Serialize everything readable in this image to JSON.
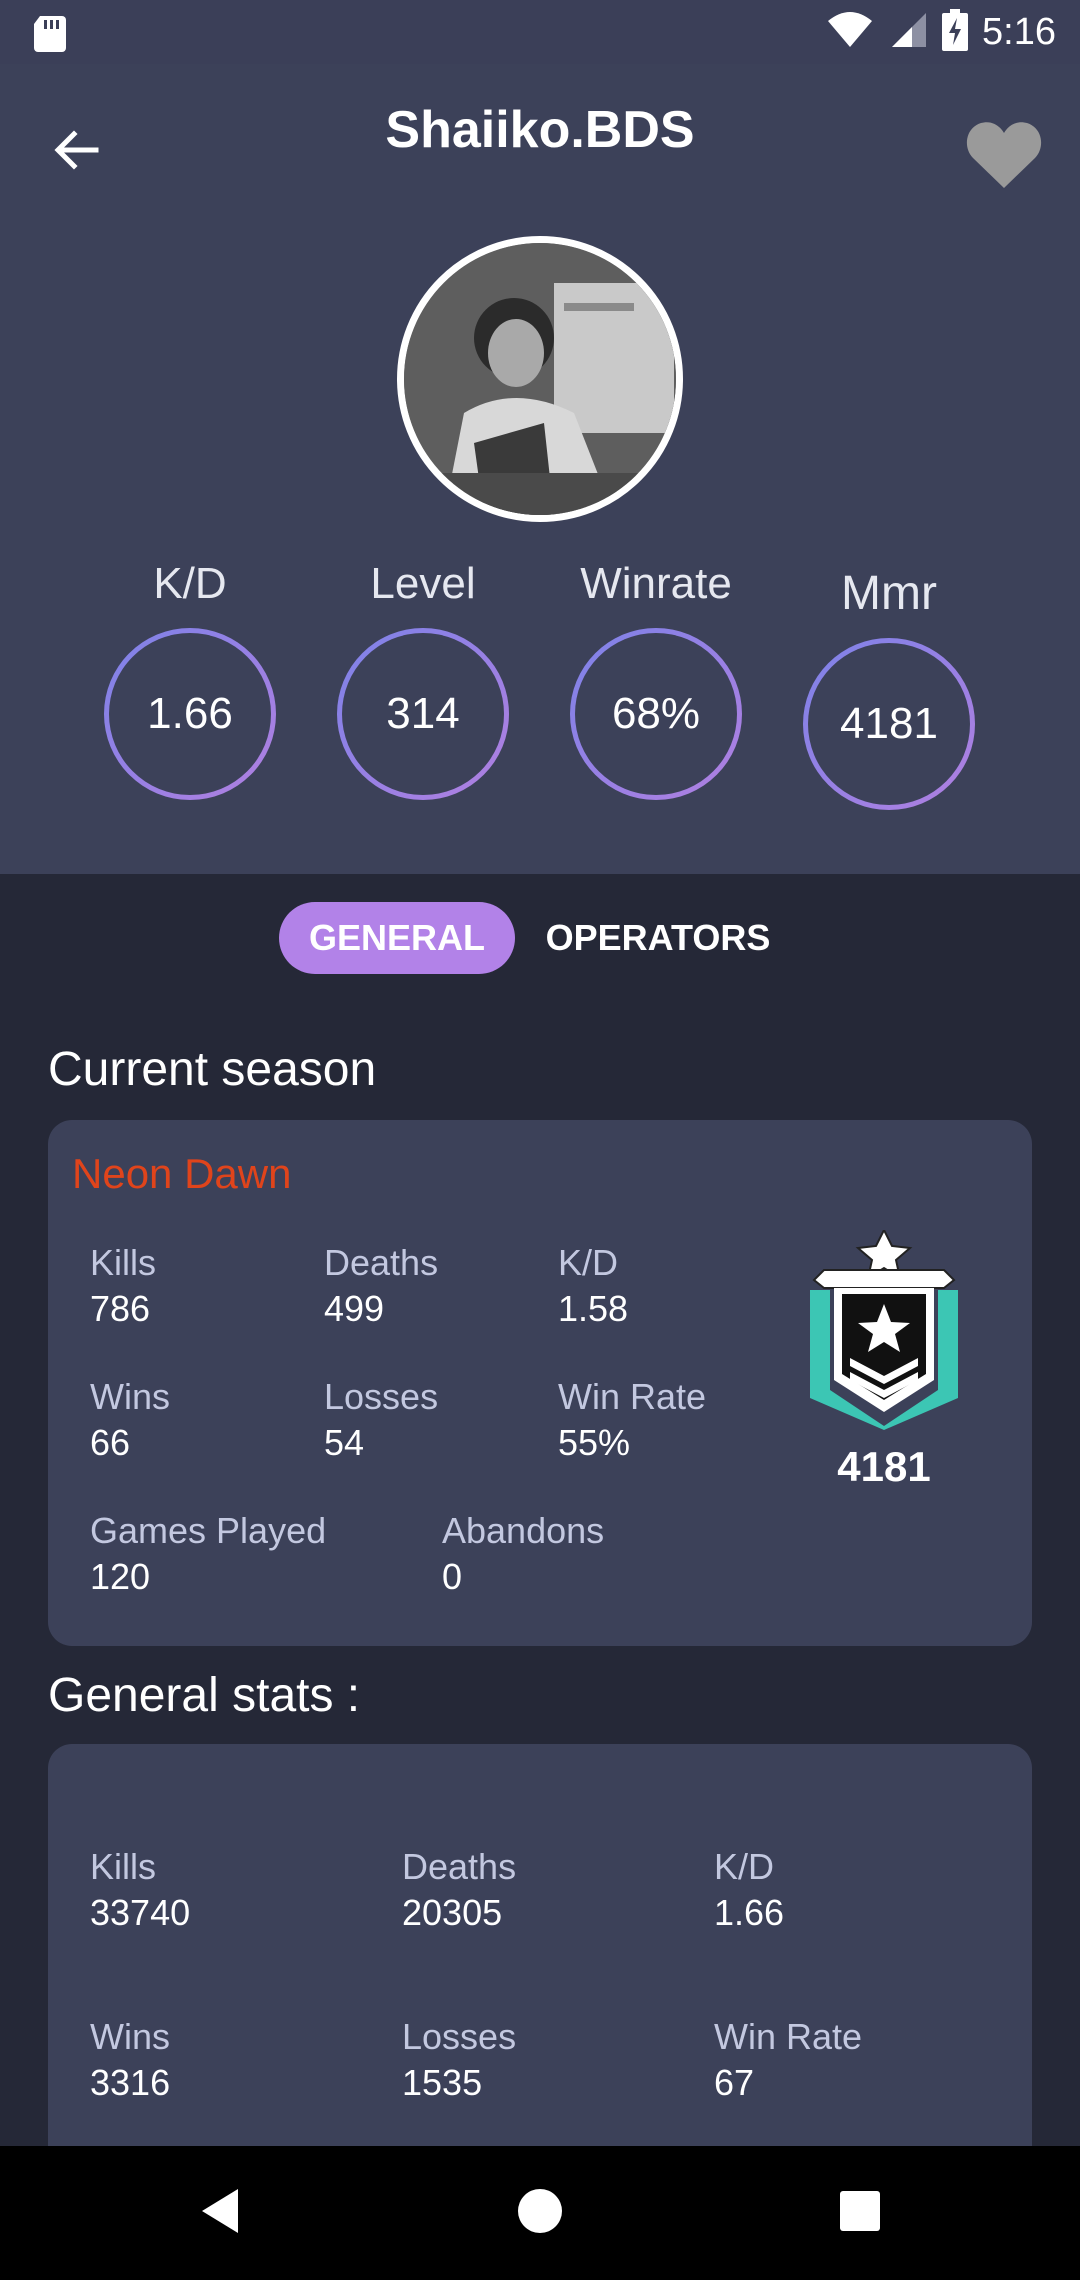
{
  "status_bar": {
    "time": "5:16",
    "icons": [
      "sd-card-icon",
      "wifi-icon",
      "signal-icon",
      "battery-icon"
    ]
  },
  "header": {
    "title": "Shaiiko.BDS",
    "back_icon": "arrow-left-icon",
    "favorite_icon": "heart-icon"
  },
  "quick_stats": [
    {
      "label": "K/D",
      "value": "1.66"
    },
    {
      "label": "Level",
      "value": "314"
    },
    {
      "label": "Winrate",
      "value": "68%"
    },
    {
      "label": "Mmr",
      "value": "4181"
    }
  ],
  "tabs": [
    {
      "label": "GENERAL",
      "active": true
    },
    {
      "label": "OPERATORS",
      "active": false
    }
  ],
  "current_season": {
    "section_title": "Current season",
    "season_name": "Neon Dawn",
    "stats": [
      {
        "label": "Kills",
        "value": "786"
      },
      {
        "label": "Deaths",
        "value": "499"
      },
      {
        "label": "K/D",
        "value": "1.58"
      },
      {
        "label": "Wins",
        "value": "66"
      },
      {
        "label": "Losses",
        "value": "54"
      },
      {
        "label": "Win Rate",
        "value": "55%"
      },
      {
        "label": "Games Played",
        "value": "120"
      },
      {
        "label": "Abandons",
        "value": "0"
      }
    ],
    "rank_icon": "rank-badge-icon",
    "rank_mmr": "4181"
  },
  "general_stats": {
    "section_title": "General stats :",
    "stats": [
      {
        "label": "Kills",
        "value": "33740"
      },
      {
        "label": "Deaths",
        "value": "20305"
      },
      {
        "label": "K/D",
        "value": "1.66"
      },
      {
        "label": "Wins",
        "value": "3316"
      },
      {
        "label": "Losses",
        "value": "1535"
      },
      {
        "label": "Win Rate",
        "value": "67"
      }
    ]
  },
  "nav_bar": {
    "icons": [
      "nav-back-icon",
      "nav-home-icon",
      "nav-recents-icon"
    ]
  },
  "colors": {
    "accent": "#b282e8",
    "season_name": "#e0441b",
    "card_bg": "#3c4159",
    "page_bg": "#252837"
  }
}
